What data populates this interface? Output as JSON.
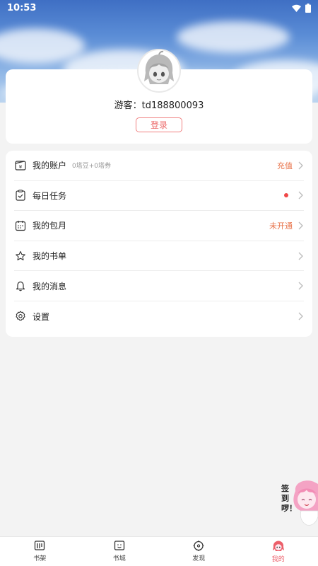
{
  "status_bar": {
    "time": "10:53"
  },
  "profile": {
    "username": "游客：td188800093",
    "login_label": "登录"
  },
  "menu": {
    "items": [
      {
        "label": "我的账户",
        "sub": "0塔豆+0塔券",
        "value": "充值",
        "icon": "wallet-icon"
      },
      {
        "label": "每日任务",
        "sub": "",
        "value": "",
        "icon": "clipboard-check-icon"
      },
      {
        "label": "我的包月",
        "sub": "",
        "value": "未开通",
        "icon": "calendar-icon"
      },
      {
        "label": "我的书单",
        "sub": "",
        "value": "",
        "icon": "star-icon"
      },
      {
        "label": "我的消息",
        "sub": "",
        "value": "",
        "icon": "bell-icon"
      },
      {
        "label": "设置",
        "sub": "",
        "value": "",
        "icon": "gear-icon"
      }
    ]
  },
  "checkin": {
    "text": "签到啰！"
  },
  "tabbar": {
    "tabs": [
      {
        "label": "书架",
        "icon": "bookshelf-icon",
        "active": false
      },
      {
        "label": "书城",
        "icon": "bookstore-icon",
        "active": false
      },
      {
        "label": "发现",
        "icon": "compass-icon",
        "active": false
      },
      {
        "label": "我的",
        "icon": "mascot-icon",
        "active": true
      }
    ]
  },
  "colors": {
    "accent": "#ec5f6a",
    "value_orange": "#e8734a",
    "dot_red": "#f04848"
  }
}
